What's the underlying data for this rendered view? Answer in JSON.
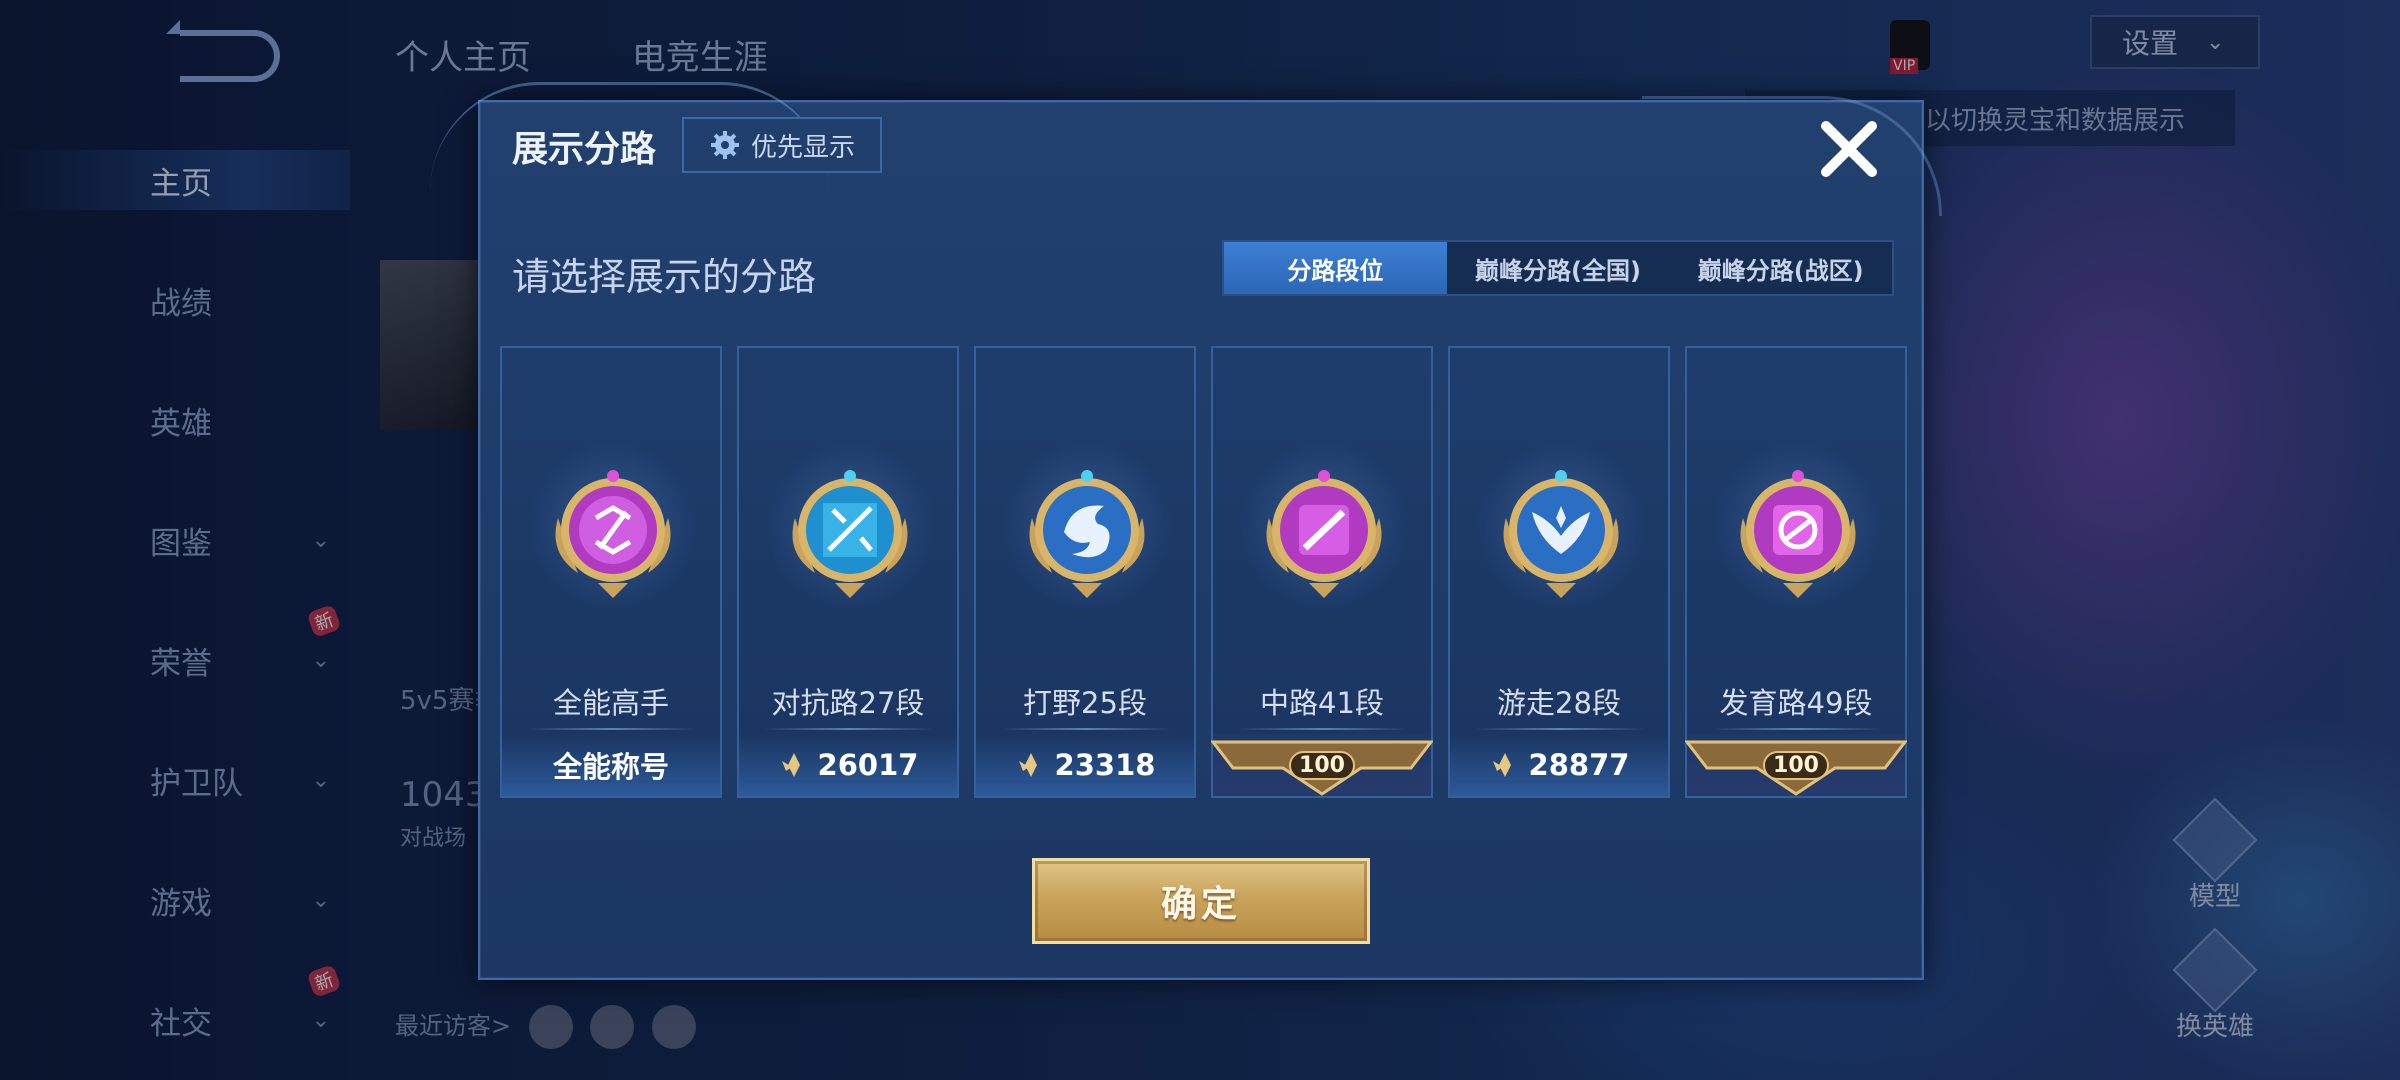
{
  "colors": {
    "accent_tab": "#3d80d4",
    "confirm_gold": "#c9a35b",
    "modal_bg": "#21406e",
    "badge_purple": "#b03ac0",
    "badge_cyan": "#37b3e8",
    "badge_blue": "#2a6fc4"
  },
  "left_nav": {
    "items": [
      {
        "label": "主页",
        "active": true
      },
      {
        "label": "战绩"
      },
      {
        "label": "英雄"
      },
      {
        "label": "图鉴",
        "expandable": true
      },
      {
        "label": "荣誉",
        "expandable": true,
        "badge": "新"
      },
      {
        "label": "护卫队",
        "expandable": true
      },
      {
        "label": "游戏",
        "expandable": true
      },
      {
        "label": "社交",
        "expandable": true,
        "badge": "新"
      }
    ]
  },
  "background": {
    "tabs": [
      "个人主页",
      "电竞生涯"
    ],
    "stat_number": "1043",
    "stat_label": "对战场",
    "season_label": "5v5赛季",
    "visitors_label": "最近访客>",
    "settings_label": "设置",
    "notice_text": "以切换灵宝和数据展示",
    "side_buttons": [
      "模型",
      "换英雄"
    ]
  },
  "modal": {
    "title": "展示分路",
    "priority_button": "优先显示",
    "subtitle": "请选择展示的分路",
    "tabs": [
      {
        "label": "分路段位",
        "active": true
      },
      {
        "label": "巅峰分路(全国)"
      },
      {
        "label": "巅峰分路(战区)"
      }
    ],
    "lanes": [
      {
        "label": "全能高手",
        "footer": "全能称号",
        "footer_type": "text",
        "badge_color": "purple",
        "icon": "all-round-icon"
      },
      {
        "label": "对抗路27段",
        "footer": "26017",
        "footer_type": "score",
        "badge_color": "cyan",
        "icon": "clash-lane-icon"
      },
      {
        "label": "打野25段",
        "footer": "23318",
        "footer_type": "score",
        "badge_color": "blue",
        "icon": "jungle-dragon-icon"
      },
      {
        "label": "中路41段",
        "footer": "100",
        "footer_type": "ribbon",
        "badge_color": "purple",
        "icon": "mid-lane-icon"
      },
      {
        "label": "游走28段",
        "footer": "28877",
        "footer_type": "score",
        "badge_color": "blue",
        "icon": "roam-wings-icon"
      },
      {
        "label": "发育路49段",
        "footer": "100",
        "footer_type": "ribbon",
        "badge_color": "purple",
        "icon": "farm-lane-icon"
      }
    ],
    "confirm_label": "确定"
  }
}
